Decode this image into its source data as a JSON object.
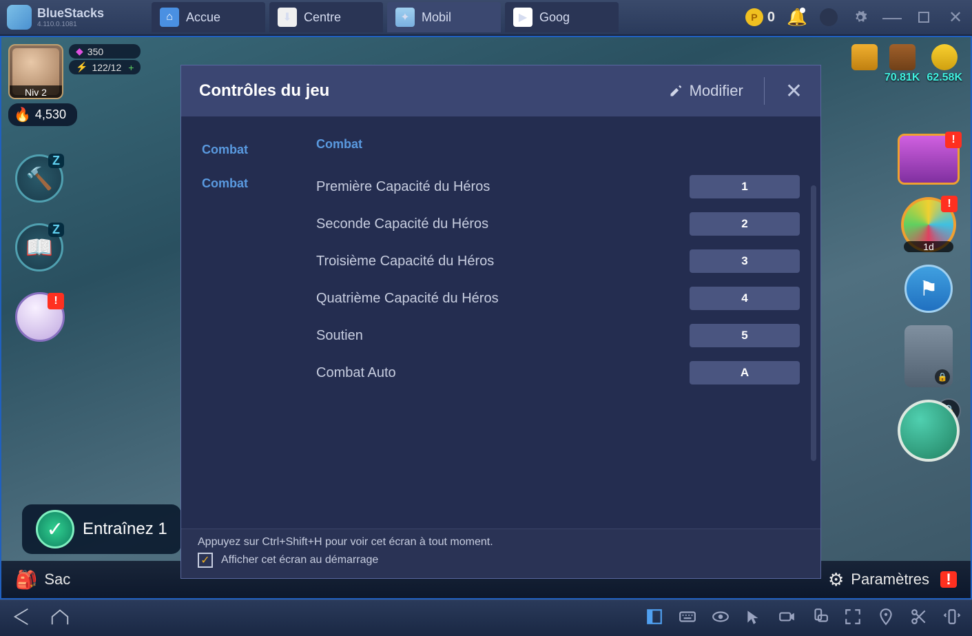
{
  "app": {
    "name": "BlueStacks",
    "version": "4.110.0.1081"
  },
  "tabs": [
    {
      "label": "Accue"
    },
    {
      "label": "Centre"
    },
    {
      "label": "Mobil"
    },
    {
      "label": "Goog"
    }
  ],
  "coins": "0",
  "game": {
    "level": "Niv 2",
    "gems": "350",
    "energy": "122/12",
    "power": "4,530",
    "resources": {
      "food": "",
      "wood": "70.81K",
      "gold": "62.58K"
    },
    "wheel_timer": "1d",
    "train_label": "Entraînez 1",
    "bag_label": "Sac",
    "settings_label": "Paramètres"
  },
  "modal": {
    "title": "Contrôles du jeu",
    "modify": "Modifier",
    "sidebar": [
      "Combat",
      "Combat"
    ],
    "section": "Combat",
    "controls": [
      {
        "label": "Première Capacité du Héros",
        "key": "1"
      },
      {
        "label": "Seconde Capacité du Héros",
        "key": "2"
      },
      {
        "label": "Troisième Capacité du Héros",
        "key": "3"
      },
      {
        "label": "Quatrième Capacité du Héros",
        "key": "4"
      },
      {
        "label": "Soutien",
        "key": "5"
      },
      {
        "label": "Combat Auto",
        "key": "A"
      }
    ],
    "footer_hint": "Appuyez sur Ctrl+Shift+H pour voir cet écran à tout moment.",
    "footer_checkbox": "Afficher cet écran au démarrage",
    "checkbox_checked": true
  }
}
